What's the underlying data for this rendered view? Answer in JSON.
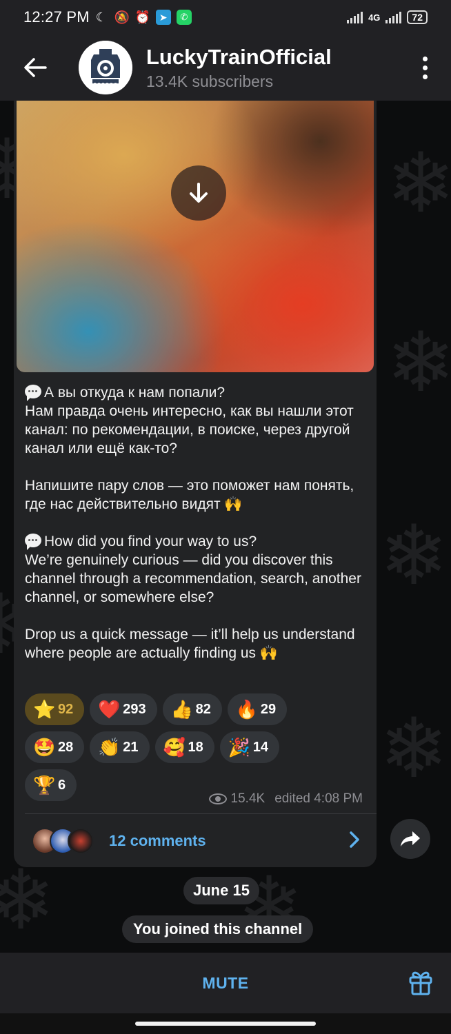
{
  "status_bar": {
    "time": "12:27 PM",
    "network": "4G",
    "battery": "72",
    "icons": [
      "moon-icon",
      "bell-off-icon",
      "alarm-icon",
      "telegram-icon",
      "whatsapp-icon"
    ]
  },
  "header": {
    "channel_name": "LuckyTrainOfficial",
    "subscribers": "13.4K subscribers"
  },
  "post": {
    "paragraphs": [
      "А вы откуда к нам попали?\nНам правда очень интересно, как вы нашли этот канал: по рекомендации, в поиске, через другой канал или ещё как-то?",
      "Напишите пару слов — это поможет нам понять, где нас действительно видят 🙌",
      "How did you find your way to us?\nWe’re genuinely curious — did you discover this channel through a recommendation, search, another channel, or somewhere else?",
      "Drop us a quick message — it’ll help us understand where people are actually finding us 🙌"
    ],
    "reactions": [
      {
        "emoji": "⭐",
        "count": "92",
        "active": true
      },
      {
        "emoji": "❤️",
        "count": "293"
      },
      {
        "emoji": "👍",
        "count": "82"
      },
      {
        "emoji": "🔥",
        "count": "29"
      },
      {
        "emoji": "🤩",
        "count": "28"
      },
      {
        "emoji": "👏",
        "count": "21"
      },
      {
        "emoji": "🥰",
        "count": "18"
      },
      {
        "emoji": "🎉",
        "count": "14"
      },
      {
        "emoji": "🏆",
        "count": "6"
      }
    ],
    "views": "15.4K",
    "edited_time": "edited 4:08 PM",
    "comments_label": "12 comments"
  },
  "service": {
    "date": "June 15",
    "joined": "You joined this channel"
  },
  "bottom": {
    "mute_label": "MUTE"
  },
  "colors": {
    "accent": "#5fb2ee",
    "bubble": "#222325",
    "star_reaction": "#e0b64a"
  }
}
